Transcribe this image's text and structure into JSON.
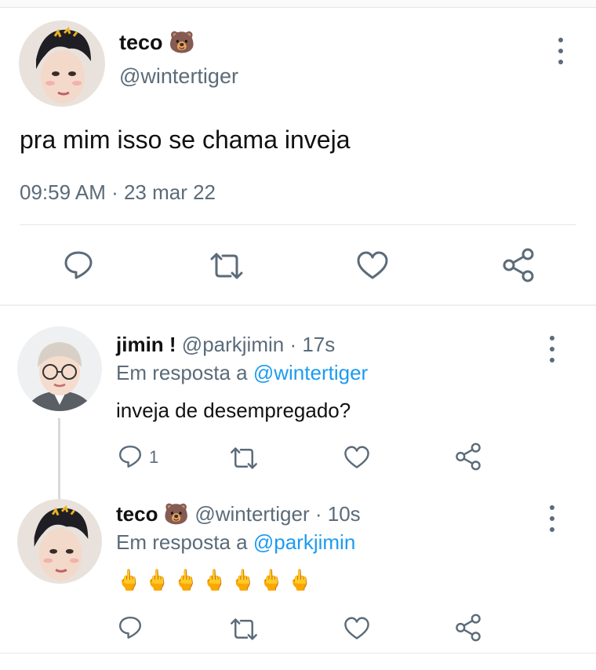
{
  "main_tweet": {
    "author_name": "teco",
    "author_emoji": "🐻",
    "author_handle": "@wintertiger",
    "text": "pra mim isso se chama inveja",
    "timestamp": "09:59 AM · 23 mar 22",
    "icons": [
      "reply-icon",
      "retweet-icon",
      "like-icon",
      "share-icon",
      "more-options-icon"
    ]
  },
  "replies": [
    {
      "author_name": "jimin !",
      "author_emoji": "",
      "author_handle": "@parkjimin",
      "time": "· 17s",
      "reply_prefix": "Em resposta a ",
      "reply_mention": "@wintertiger",
      "text": "inveja de desempregado?",
      "reply_count": "1"
    },
    {
      "author_name": "teco",
      "author_emoji": "🐻",
      "author_handle": "@wintertiger",
      "time": "· 10s",
      "reply_prefix": "Em resposta a ",
      "reply_mention": "@parkjimin",
      "text": "🖕🖕🖕🖕🖕🖕🖕",
      "reply_count": ""
    }
  ],
  "colors": {
    "text": "#111111",
    "secondary": "#5b6b79",
    "mention": "#1d9bf0",
    "divider": "#e6e6e6"
  }
}
